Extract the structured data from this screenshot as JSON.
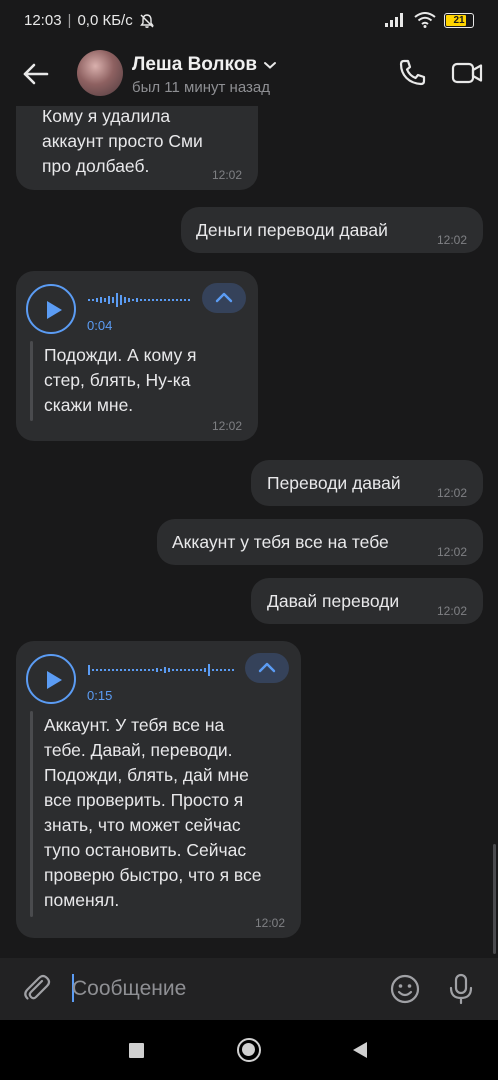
{
  "status_bar": {
    "time": "12:03",
    "network_speed": "0,0 КБ/с",
    "battery_level": "21",
    "battery_color": "#ffd400"
  },
  "header": {
    "contact_name": "Леша Волков",
    "last_seen": "был 11 минут назад",
    "icons": [
      "back-arrow-icon",
      "chevron-down-icon",
      "phone-icon",
      "video-icon"
    ]
  },
  "messages": [
    {
      "direction": "incoming",
      "type": "text",
      "lines": [
        "Кому я удалила",
        "аккаунт просто Сми",
        "про долбаеб."
      ],
      "time": "12:02"
    },
    {
      "direction": "outgoing",
      "type": "text",
      "text": "Деньги переводи давай",
      "time": "12:02"
    },
    {
      "direction": "incoming",
      "type": "voice",
      "duration": "0:04",
      "transcript_lines": [
        "Подожди. А кому я",
        "стер, блять, Ну-ка",
        "скажи мне."
      ],
      "time": "12:02"
    },
    {
      "direction": "outgoing",
      "type": "text",
      "text": "Переводи давай",
      "time": "12:02"
    },
    {
      "direction": "outgoing",
      "type": "text",
      "text": "Аккаунт у тебя все на тебе",
      "time": "12:02"
    },
    {
      "direction": "outgoing",
      "type": "text",
      "text": "Давай переводи",
      "time": "12:02"
    },
    {
      "direction": "incoming",
      "type": "voice",
      "duration": "0:15",
      "transcript_lines": [
        "Аккаунт. У тебя все на",
        "тебе. Давай, переводи.",
        "Подожди, блять, дай мне",
        "все проверить. Просто я",
        "знать, что может сейчас",
        "тупо остановить. Сейчас",
        "проверю быстро, что я все",
        "поменял."
      ],
      "time": "12:02"
    }
  ],
  "composer": {
    "placeholder": "Сообщение",
    "value": "",
    "icons": [
      "attach-icon",
      "emoji-icon",
      "microphone-icon"
    ]
  },
  "colors": {
    "background": "#19191a",
    "bubble": "#2c2d2f",
    "accent": "#5b9cf4"
  }
}
